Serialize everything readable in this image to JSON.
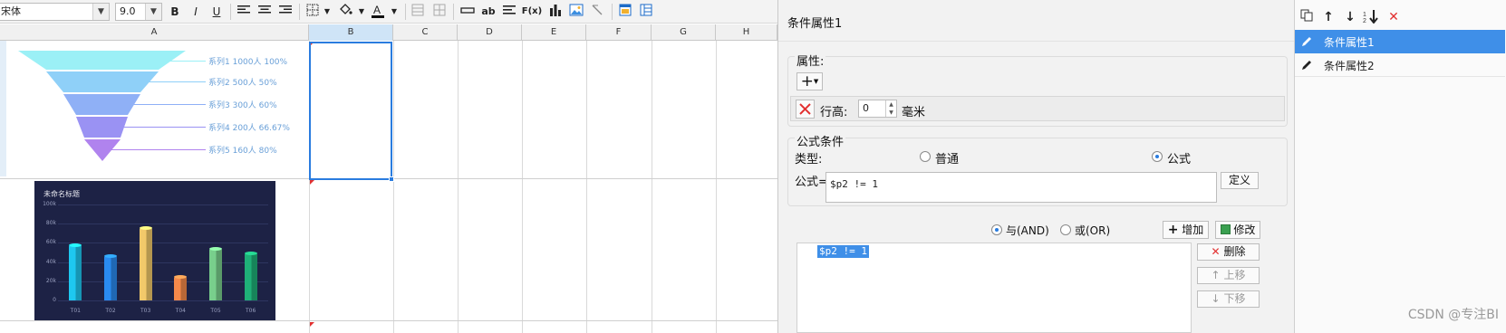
{
  "toolbar": {
    "font_name": "宋体",
    "font_size": "9.0",
    "bold": "B",
    "italic": "I",
    "underline": "U",
    "text_ab": "ab",
    "formula_label": "F(x)"
  },
  "columns": [
    "A",
    "B",
    "C",
    "D",
    "E",
    "F",
    "G",
    "H"
  ],
  "funnel": {
    "labels": [
      "系列1  1000人  100%",
      "系列2  500人  50%",
      "系列3  300人  60%",
      "系列4  200人  66.67%",
      "系列5  160人  80%"
    ],
    "colors": [
      "#9bf0f6",
      "#8fd0f8",
      "#8fb0f6",
      "#9a92f3",
      "#b083ee"
    ]
  },
  "chart_data": {
    "type": "bar",
    "title": "未命名标题",
    "categories": [
      "T01",
      "T02",
      "T03",
      "T04",
      "T05",
      "T06"
    ],
    "series": [
      {
        "values": [
          57,
          45,
          75,
          24,
          53,
          48
        ]
      }
    ],
    "ylim": [
      0,
      100
    ],
    "ytick_labels": [
      "0",
      "20k",
      "40k",
      "60k",
      "80k",
      "100k"
    ],
    "bar_colors": [
      "#1ec8f0",
      "#2a8bf0",
      "#f2c96a",
      "#f5894a",
      "#78cf8c",
      "#1fb078"
    ],
    "background": "#1d2245"
  },
  "dialog": {
    "title": "条件属性1",
    "attr_group_label": "属性:",
    "add_button": "+",
    "row_height_label": "行高:",
    "row_height_value": "0",
    "row_height_unit": "毫米",
    "formula_group_label": "公式条件",
    "type_label": "类型:",
    "type_options": [
      "普通",
      "公式"
    ],
    "type_selected": "公式",
    "formula_label": "公式=",
    "formula_value": "$p2 != 1",
    "define_button": "定义",
    "logic_options": [
      "与(AND)",
      "或(OR)"
    ],
    "logic_selected": "与(AND)",
    "add_cond_button": "增加",
    "modify_button": "修改",
    "condition_item": "$p2 != 1",
    "delete_button": "删除",
    "move_up_button": "上移",
    "move_down_button": "下移"
  },
  "right_panel": {
    "items": [
      "条件属性1",
      "条件属性2"
    ],
    "selected": "条件属性1"
  },
  "watermark": "CSDN @专注BI"
}
